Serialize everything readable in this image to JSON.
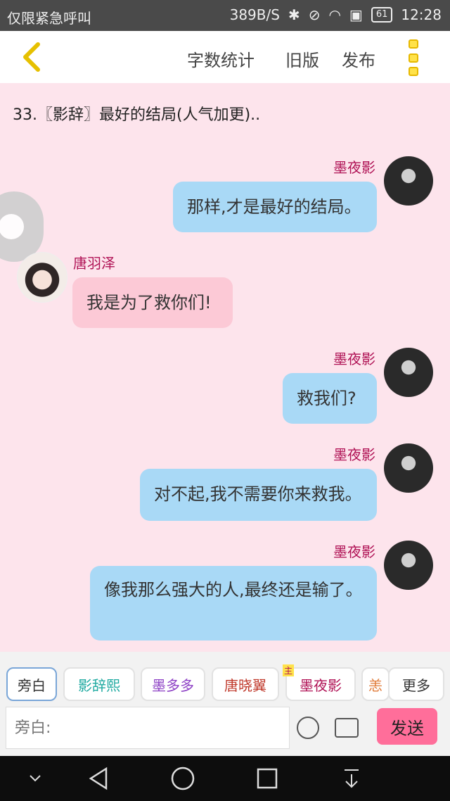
{
  "status_bar": {
    "left_text": "仅限紧急呼叫",
    "speed": "389B/S",
    "battery": "61",
    "time": "12:28",
    "icons": [
      "bluetooth-icon",
      "mute-icon",
      "wifi-icon",
      "sim-icon",
      "battery-icon"
    ]
  },
  "header": {
    "back_icon": "chevron-left-icon",
    "actions": [
      "字数统计",
      "旧版",
      "发布"
    ],
    "menu_icon": "more-vertical-icon"
  },
  "chapter_title": "33.〖影辞〗最好的结局(人气加更)..",
  "messages": [
    {
      "side": "right",
      "name": "墨夜影",
      "text": "那样,才是最好的结局。"
    },
    {
      "side": "left",
      "name": "唐羽泽",
      "text": "我是为了救你们!"
    },
    {
      "side": "right",
      "name": "墨夜影",
      "text": "救我们?"
    },
    {
      "side": "right",
      "name": "墨夜影",
      "text": "对不起,我不需要你来救我。"
    },
    {
      "side": "right",
      "name": "墨夜影",
      "text": "像我那么强大的人,最终还是输了。"
    }
  ],
  "character_chips": [
    "旁白",
    "影辞熙",
    "墨多多",
    "唐晓翼",
    "墨夜影",
    "恙",
    "更多"
  ],
  "chip_tag": "主",
  "input": {
    "placeholder": "旁白:"
  },
  "send_label": "发送",
  "colors": {
    "accent": "#ff6e9a",
    "bubble_blue": "#a9d9f6",
    "bubble_pink": "#fcc9d6",
    "background": "#fde4ec",
    "name_color": "#b01255"
  }
}
